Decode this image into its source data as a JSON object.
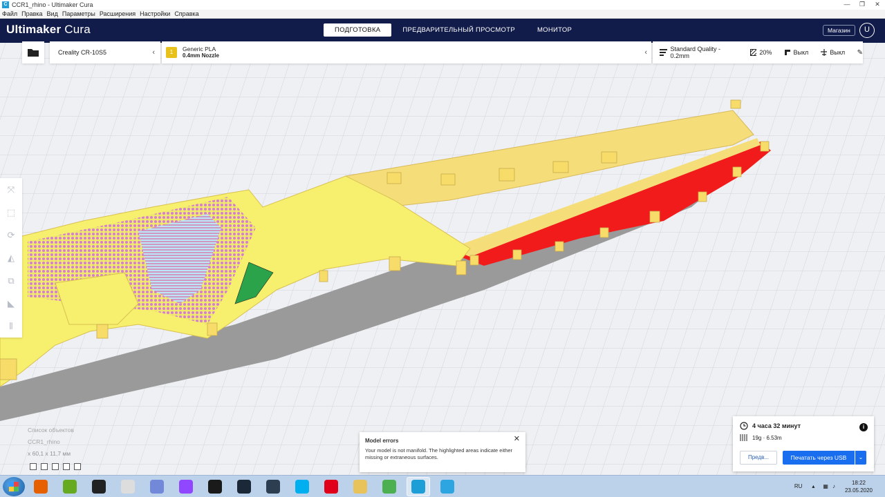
{
  "window": {
    "title": "CCR1_rhino - Ultimaker Cura",
    "app_icon": "C"
  },
  "menu": [
    "Файл",
    "Правка",
    "Вид",
    "Параметры",
    "Расширения",
    "Настройки",
    "Справка"
  ],
  "header": {
    "brand_bold": "Ultimaker",
    "brand_light": "Cura",
    "stages": [
      "ПОДГОТОВКА",
      "ПРЕДВАРИТЕЛЬНЫЙ ПРОСМОТР",
      "МОНИТОР"
    ],
    "active_stage": 0,
    "shop": "Магазин",
    "user_initial": "U",
    "bg_color": "#121c4a"
  },
  "printer": {
    "name": "Creality CR-10S5"
  },
  "material": {
    "badge": "1",
    "name": "Generic PLA",
    "nozzle": "0.4mm Nozzle",
    "color": "#e8c11a"
  },
  "quality": {
    "profile": "Standard Quality - 0.2mm",
    "infill": "20%",
    "support": "Выкл",
    "adhesion": "Выкл"
  },
  "objects": {
    "label": "Список объектов",
    "name": "CCR1_rhino",
    "dims": "x 60,1 x 11,7 мм"
  },
  "toast": {
    "title": "Model errors",
    "body": "Your model is not manifold. The highlighted areas indicate either missing or extraneous surfaces."
  },
  "print": {
    "time": "4 часа 32 минут",
    "material": "19g · 6.53m",
    "preview": "Предв...",
    "print_button": "Печатать через USB",
    "accent": "#196ef0"
  },
  "tray": {
    "lang": "RU",
    "time": "18:22",
    "date": "23.05.2020"
  },
  "taskbar_apps": [
    {
      "name": "firefox-icon",
      "color": "#e66000"
    },
    {
      "name": "fractal-icon",
      "color": "#6a2"
    },
    {
      "name": "game-icon",
      "color": "#222"
    },
    {
      "name": "notepad-icon",
      "color": "#ddd"
    },
    {
      "name": "discord-icon",
      "color": "#7289da"
    },
    {
      "name": "twitch-icon",
      "color": "#9146ff"
    },
    {
      "name": "nvidia-icon",
      "color": "#1a1a1a"
    },
    {
      "name": "steam-icon",
      "color": "#1b2838"
    },
    {
      "name": "teamspeak-icon",
      "color": "#2c3e50"
    },
    {
      "name": "skype-icon",
      "color": "#00aff0"
    },
    {
      "name": "opera-icon",
      "color": "#e0001a"
    },
    {
      "name": "explorer-icon",
      "color": "#e8c25a"
    },
    {
      "name": "chrome-icon",
      "color": "#4caf50"
    },
    {
      "name": "cura-icon",
      "color": "#1e9ed6"
    },
    {
      "name": "telegram-icon",
      "color": "#2ca5e0"
    }
  ]
}
